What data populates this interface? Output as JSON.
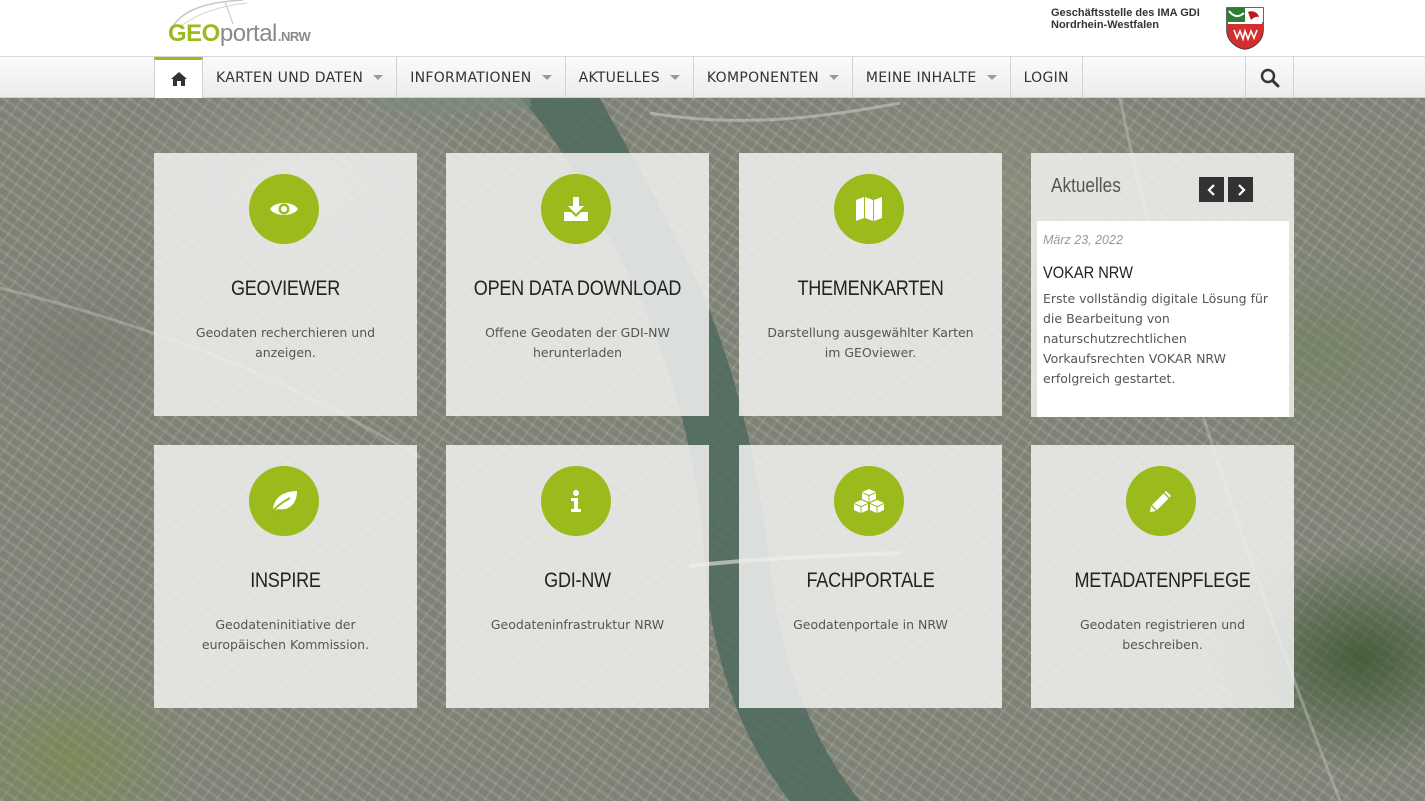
{
  "header": {
    "logo": {
      "geo": "GEO",
      "portal": "portal",
      "nrw": ".NRW"
    },
    "org_line1": "Geschäftsstelle des IMA GDI",
    "org_line2": "Nordrhein-Westfalen"
  },
  "nav": {
    "home_icon": "home-icon",
    "items": [
      {
        "label": "KARTEN UND DATEN",
        "dropdown": true
      },
      {
        "label": "INFORMATIONEN",
        "dropdown": true
      },
      {
        "label": "AKTUELLES",
        "dropdown": true
      },
      {
        "label": "KOMPONENTEN",
        "dropdown": true
      },
      {
        "label": "MEINE INHALTE",
        "dropdown": true
      },
      {
        "label": "LOGIN",
        "dropdown": false
      }
    ],
    "search_icon": "search-icon"
  },
  "tiles": [
    {
      "icon": "eye-icon",
      "title": "GEOVIEWER",
      "desc": "Geodaten recherchieren und anzeigen."
    },
    {
      "icon": "download-icon",
      "title": "OPEN DATA DOWNLOAD",
      "desc": "Offene Geodaten der GDI-NW herunterladen"
    },
    {
      "icon": "map-icon",
      "title": "THEMENKARTEN",
      "desc": "Darstellung ausgewählter Karten im GEOviewer."
    },
    {
      "icon": "leaf-icon",
      "title": "INSPIRE",
      "desc": "Geodateninitiative der europäischen Kommission."
    },
    {
      "icon": "info-icon",
      "title": "GDI-NW",
      "desc": "Geodateninfrastruktur NRW"
    },
    {
      "icon": "cubes-icon",
      "title": "FACHPORTALE",
      "desc": "Geodatenportale in NRW"
    },
    {
      "icon": "pencil-icon",
      "title": "METADATENPFLEGE",
      "desc": "Geodaten registrieren und beschreiben."
    }
  ],
  "news": {
    "heading": "Aktuelles",
    "date": "März 23, 2022",
    "title": "VOKAR NRW",
    "text": "Erste vollständig digitale Lösung für die Bearbeitung von naturschutzrechtlichen Vorkaufsrechten VOKAR NRW erfolgreich gestartet."
  },
  "colors": {
    "accent": "#9bba1c",
    "nav_active": "#9bba1c",
    "arrow_bg": "#333333"
  }
}
